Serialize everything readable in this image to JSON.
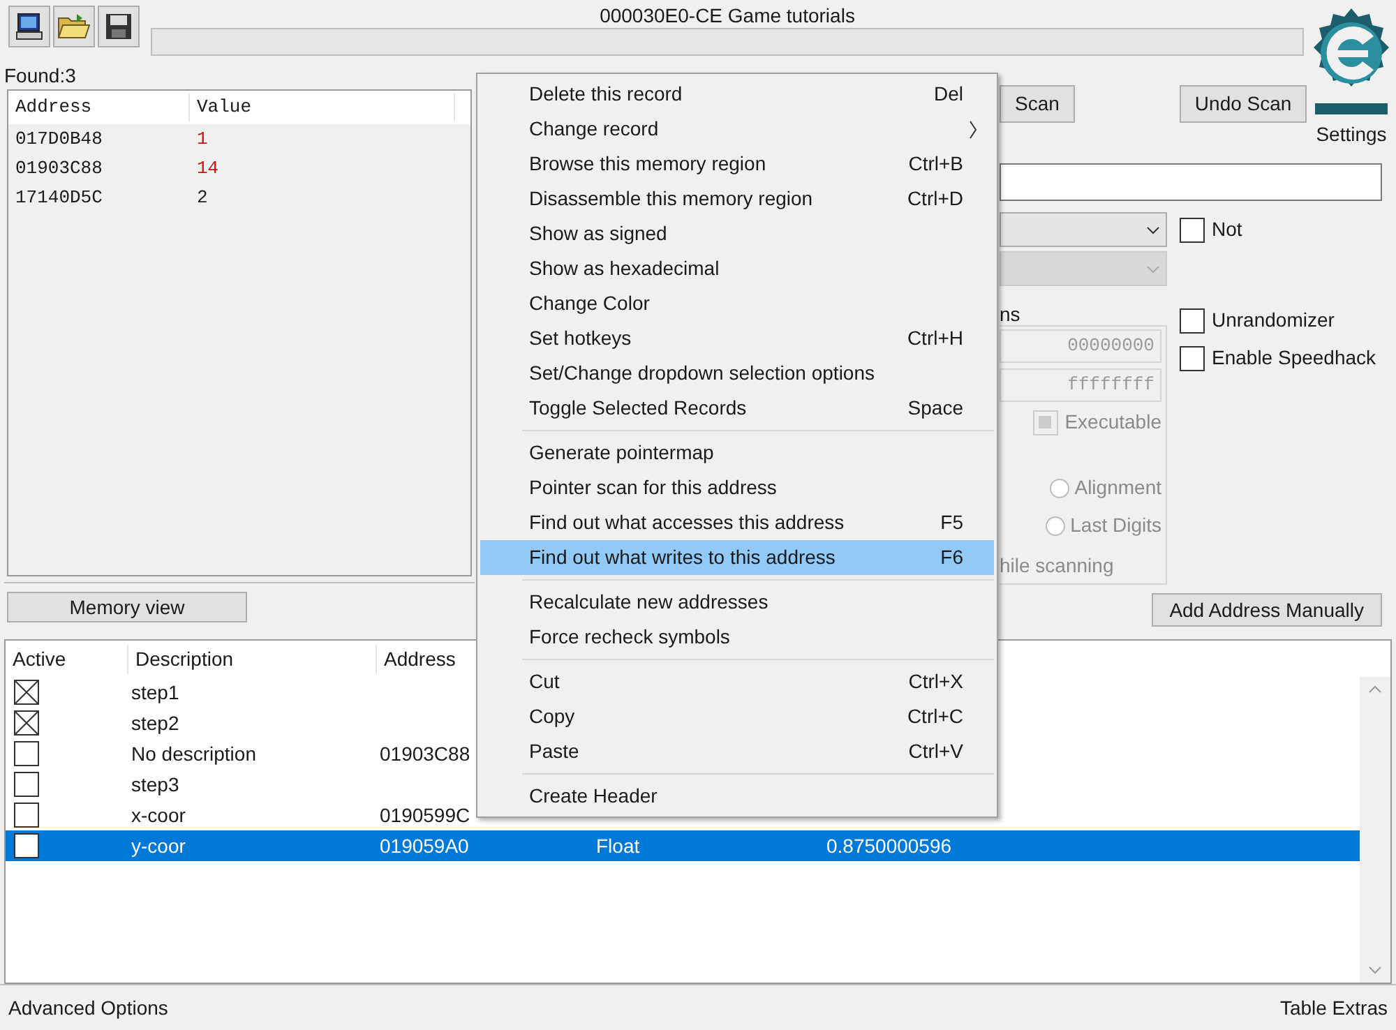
{
  "window": {
    "title": "000030E0-CE Game tutorials"
  },
  "progress": {
    "level": 0
  },
  "toolbar": [
    {
      "kind": "computer"
    },
    {
      "kind": "folder"
    },
    {
      "kind": "disk"
    }
  ],
  "found": "Found:3",
  "found_list": {
    "columns": [
      "Address",
      "Value"
    ],
    "rows": [
      {
        "address": "017D0B48",
        "value": "1",
        "changed": true
      },
      {
        "address": "01903C88",
        "value": "14",
        "changed": true
      },
      {
        "address": "17140D5C",
        "value": "2",
        "changed": false
      }
    ]
  },
  "memory_view_button": "Memory view",
  "scan_buttons": [
    "Scan",
    "Undo Scan"
  ],
  "settings": "Settings",
  "scan_options": {
    "not": {
      "label": "Not",
      "checked": false
    },
    "group_label": "ns",
    "start": "00000000",
    "stop": "ffffffff",
    "executable": {
      "label": "Executable",
      "disabled": true
    },
    "radios": [
      {
        "label": "Alignment",
        "selected": false
      },
      {
        "label": "Last Digits",
        "selected": false
      }
    ],
    "scanning_label": "hile scanning",
    "options": [
      {
        "label": "Unrandomizer",
        "checked": false
      },
      {
        "label": "Enable Speedhack",
        "checked": false
      }
    ]
  },
  "add_address_button": "Add Address Manually",
  "address_list": {
    "columns": [
      "Active",
      "Description",
      "Address"
    ],
    "rows": [
      {
        "active": true,
        "description": "step1",
        "selected": false
      },
      {
        "active": true,
        "description": "step2",
        "selected": false
      },
      {
        "active": false,
        "description": "No description",
        "address": "01903C88",
        "selected": false
      },
      {
        "active": false,
        "description": "step3",
        "selected": false
      },
      {
        "active": false,
        "description": "x-coor",
        "address": "0190599C",
        "selected": false
      },
      {
        "active": false,
        "description": "y-coor",
        "address": "019059A0",
        "type": "Float",
        "value": "0.8750000596",
        "selected": true
      }
    ]
  },
  "context_menu": {
    "groups": [
      [
        {
          "label": "Delete this record",
          "shortcut": "Del",
          "submenu": false,
          "highlighted": false
        },
        {
          "label": "Change record",
          "submenu": true,
          "highlighted": false
        },
        {
          "label": "Browse this memory region",
          "shortcut": "Ctrl+B",
          "submenu": false,
          "highlighted": false
        },
        {
          "label": "Disassemble this memory region",
          "shortcut": "Ctrl+D",
          "submenu": false,
          "highlighted": false
        },
        {
          "label": "Show as signed",
          "submenu": false,
          "highlighted": false
        },
        {
          "label": "Show as hexadecimal",
          "submenu": false,
          "highlighted": false
        },
        {
          "label": "Change Color",
          "submenu": false,
          "highlighted": false
        },
        {
          "label": "Set hotkeys",
          "shortcut": "Ctrl+H",
          "submenu": false,
          "highlighted": false
        },
        {
          "label": "Set/Change dropdown selection options",
          "submenu": false,
          "highlighted": false
        },
        {
          "label": "Toggle Selected Records",
          "shortcut": "Space",
          "submenu": false,
          "highlighted": false
        }
      ],
      [
        {
          "label": "Generate pointermap",
          "submenu": false,
          "highlighted": false
        },
        {
          "label": "Pointer scan for this address",
          "submenu": false,
          "highlighted": false
        },
        {
          "label": "Find out what accesses this address",
          "shortcut": "F5",
          "submenu": false,
          "highlighted": false
        },
        {
          "label": "Find out what writes to this address",
          "shortcut": "F6",
          "submenu": false,
          "highlighted": true
        }
      ],
      [
        {
          "label": "Recalculate new addresses",
          "submenu": false,
          "highlighted": false
        },
        {
          "label": "Force recheck symbols",
          "submenu": false,
          "highlighted": false
        }
      ],
      [
        {
          "label": "Cut",
          "shortcut": "Ctrl+X",
          "submenu": false,
          "highlighted": false
        },
        {
          "label": "Copy",
          "shortcut": "Ctrl+C",
          "submenu": false,
          "highlighted": false
        },
        {
          "label": "Paste",
          "shortcut": "Ctrl+V",
          "submenu": false,
          "highlighted": false
        }
      ],
      [
        {
          "label": "Create Header",
          "submenu": false,
          "highlighted": false
        }
      ]
    ]
  },
  "status_bar": {
    "left": "Advanced Options",
    "right": "Table Extras"
  }
}
